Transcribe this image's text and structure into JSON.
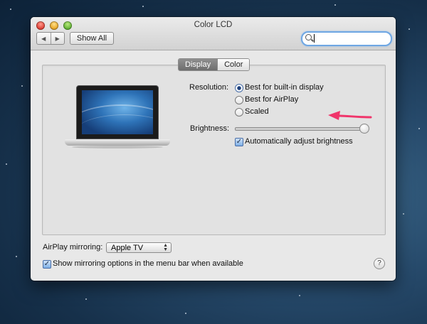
{
  "window": {
    "title": "Color LCD",
    "show_all_label": "Show All",
    "nav_back": "◀",
    "nav_forward": "▶",
    "search": {
      "value": "",
      "placeholder": ""
    }
  },
  "tabs": [
    {
      "label": "Display",
      "active": true
    },
    {
      "label": "Color",
      "active": false
    }
  ],
  "display": {
    "resolution_label": "Resolution:",
    "resolution_options": [
      {
        "label": "Best for built-in display",
        "selected": true
      },
      {
        "label": "Best for AirPlay",
        "selected": false
      },
      {
        "label": "Scaled",
        "selected": false
      }
    ],
    "brightness_label": "Brightness:",
    "brightness_level": 1.0,
    "auto_brightness_label": "Automatically adjust brightness",
    "auto_brightness_checked": true
  },
  "airplay": {
    "mirroring_label": "AirPlay mirroring:",
    "selected": "Apple TV",
    "show_in_menubar_label": "Show mirroring options in the menu bar when available",
    "show_in_menubar_checked": true
  },
  "help_label": "?",
  "colors": {
    "annotation_arrow": "#f0356b",
    "accent": "#4a6fa8"
  },
  "icons": [
    "search-icon",
    "help-icon",
    "laptop-icon",
    "checkmark-icon",
    "arrow-annotation"
  ]
}
